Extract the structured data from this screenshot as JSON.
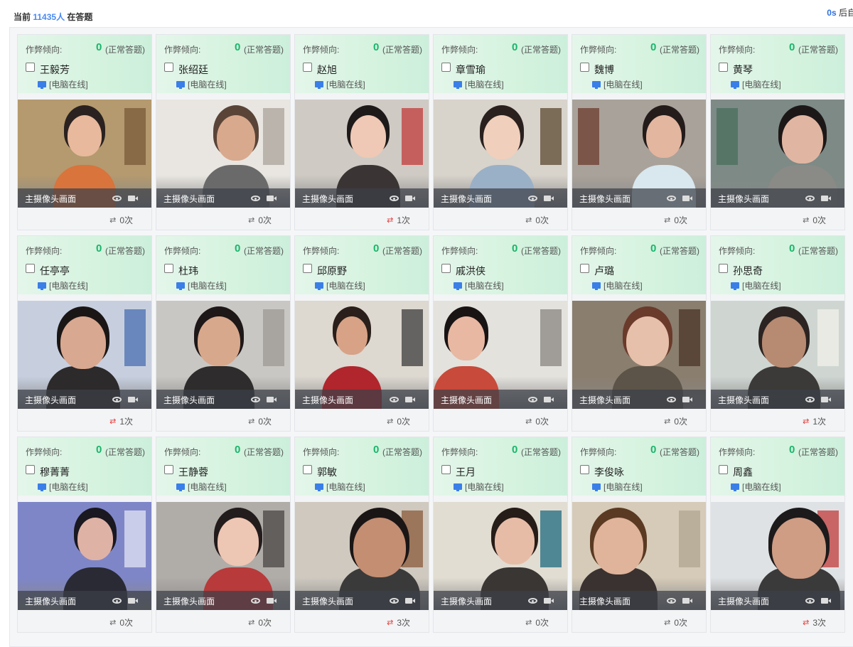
{
  "header": {
    "prefix": "当前",
    "count": "11435人",
    "suffix": "在答题",
    "right_secs": "0s",
    "right_text": "后自"
  },
  "card_common": {
    "tendency_label": "作弊倾向:",
    "score": "0",
    "score_text": "(正常答题)",
    "online": "[电脑在线]",
    "camera_label": "主摄像头画面"
  },
  "students": [
    {
      "name": "王毅芳",
      "switch": "0次",
      "alert": false,
      "scene": {
        "wall": "#b49a6e",
        "skin": "#e8b99c",
        "hair": "#2a2220",
        "shirt": "#d9743c",
        "hx": 70,
        "hw": 48,
        "prop": "#7a5a3a"
      }
    },
    {
      "name": "张绍廷",
      "switch": "0次",
      "alert": false,
      "scene": {
        "wall": "#e9e6e1",
        "skin": "#d9a98e",
        "hair": "#5a4438",
        "shirt": "#6a6a6a",
        "hx": 85,
        "hw": 54,
        "prop": "#a9a39a"
      }
    },
    {
      "name": "赵旭",
      "switch": "1次",
      "alert": true,
      "scene": {
        "wall": "#cfcac4",
        "skin": "#efc9b5",
        "hair": "#1e1a1a",
        "shirt": "#3a3434",
        "hx": 78,
        "hw": 50,
        "prop": "#c23b3b"
      }
    },
    {
      "name": "章雪瑜",
      "switch": "0次",
      "alert": false,
      "scene": {
        "wall": "#d8d3cb",
        "skin": "#f0cfbc",
        "hair": "#2a211e",
        "shirt": "#9ab0c6",
        "hx": 70,
        "hw": 52,
        "prop": "#5c4a32"
      }
    },
    {
      "name": "魏博",
      "switch": "0次",
      "alert": false,
      "scene": {
        "wall": "#a9a29a",
        "skin": "#e3b6a0",
        "hair": "#231c1b",
        "shirt": "#d9e7ee",
        "hx": 104,
        "hw": 50,
        "prop": "#6d3b2e"
      }
    },
    {
      "name": "黄琴",
      "switch": "0次",
      "alert": false,
      "scene": {
        "wall": "#7d8a86",
        "skin": "#e0b6a2",
        "hair": "#1d1818",
        "shirt": "#8a8a86",
        "hx": 100,
        "hw": 58,
        "prop": "#4a6e5c"
      }
    },
    {
      "name": "任亭亭",
      "switch": "1次",
      "alert": true,
      "scene": {
        "wall": "#c7cfdf",
        "skin": "#d9a890",
        "hair": "#1a1616",
        "shirt": "#2c2a2a",
        "hx": 60,
        "hw": 64,
        "prop": "#4a6fb1"
      }
    },
    {
      "name": "杜玮",
      "switch": "0次",
      "alert": false,
      "scene": {
        "wall": "#c9c7c3",
        "skin": "#d8a88c",
        "hair": "#1e1818",
        "shirt": "#2e2c2c",
        "hx": 58,
        "hw": 60,
        "prop": "#9c9894"
      }
    },
    {
      "name": "邱原野",
      "switch": "0次",
      "alert": false,
      "scene": {
        "wall": "#ddd8d0",
        "skin": "#d7a286",
        "hair": "#2a1f1a",
        "shirt": "#b0262c",
        "hx": 58,
        "hw": 44,
        "prop": "#3c3c3c"
      }
    },
    {
      "name": "戚洪侠",
      "switch": "0次",
      "alert": false,
      "scene": {
        "wall": "#e4e2dd",
        "skin": "#e8b8a2",
        "hair": "#191414",
        "shirt": "#c84a3a",
        "hx": 20,
        "hw": 52,
        "prop": "#8a8680"
      }
    },
    {
      "name": "卢璐",
      "switch": "0次",
      "alert": false,
      "scene": {
        "wall": "#8a7e6e",
        "skin": "#e6c0aa",
        "hair": "#6a3a2a",
        "shirt": "#5c5448",
        "hx": 76,
        "hw": 60,
        "prop": "#4a3628"
      }
    },
    {
      "name": "孙思奇",
      "switch": "1次",
      "alert": true,
      "scene": {
        "wall": "#cfd6d2",
        "skin": "#b78a72",
        "hair": "#2b2422",
        "shirt": "#3c3a38",
        "hx": 72,
        "hw": 62,
        "prop": "#f0f0e8"
      }
    },
    {
      "name": "穆菁菁",
      "switch": "0次",
      "alert": false,
      "scene": {
        "wall": "#7f86c8",
        "skin": "#dfb2a6",
        "hair": "#1a1820",
        "shirt": "#2a2a34",
        "hx": 84,
        "hw": 50,
        "prop": "#e2e4f4"
      }
    },
    {
      "name": "王静蓉",
      "switch": "0次",
      "alert": false,
      "scene": {
        "wall": "#b0aca8",
        "skin": "#eec6b4",
        "hair": "#231c1c",
        "shirt": "#b83a3a",
        "hx": 86,
        "hw": 58,
        "prop": "#4a4644"
      }
    },
    {
      "name": "郭敏",
      "switch": "3次",
      "alert": true,
      "scene": {
        "wall": "#cfc9bf",
        "skin": "#c48e72",
        "hair": "#1b1616",
        "shirt": "#3a3a3a",
        "hx": 82,
        "hw": 74,
        "prop": "#8a5a3a"
      }
    },
    {
      "name": "王月",
      "switch": "0次",
      "alert": false,
      "scene": {
        "wall": "#e2ddd2",
        "skin": "#e7bca6",
        "hair": "#261c18",
        "shirt": "#3a3634",
        "hx": 86,
        "hw": 56,
        "prop": "#1f6a80"
      }
    },
    {
      "name": "李俊咏",
      "switch": "0次",
      "alert": false,
      "scene": {
        "wall": "#d6cbb8",
        "skin": "#e0b49a",
        "hair": "#5a3a22",
        "shirt": "#3a3230",
        "hx": 30,
        "hw": 70,
        "prop": "#b0a690"
      }
    },
    {
      "name": "周鑫",
      "switch": "3次",
      "alert": true,
      "scene": {
        "wall": "#dfe2e4",
        "skin": "#cf9c84",
        "hair": "#1c1a1a",
        "shirt": "#3a3a3a",
        "hx": 86,
        "hw": 76,
        "prop": "#c23b3b"
      }
    }
  ]
}
